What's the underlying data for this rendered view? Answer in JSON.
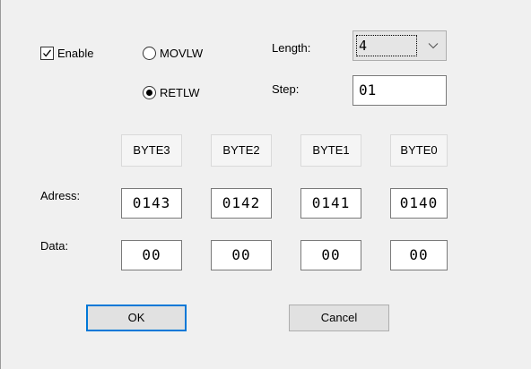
{
  "options": {
    "enable_label": "Enable",
    "enable_checked": true,
    "radio_movlw_label": "MOVLW",
    "radio_retlw_label": "RETLW",
    "selected_radio": "RETLW"
  },
  "settings": {
    "length_label": "Length:",
    "length_value": "4",
    "step_label": "Step:",
    "step_value": "01"
  },
  "table": {
    "byte_headers": [
      "BYTE3",
      "BYTE2",
      "BYTE1",
      "BYTE0"
    ],
    "address_label": "Adress:",
    "addresses": [
      "0143",
      "0142",
      "0141",
      "0140"
    ],
    "data_label": "Data:",
    "data_values": [
      "00",
      "00",
      "00",
      "00"
    ]
  },
  "buttons": {
    "ok_label": "OK",
    "cancel_label": "Cancel"
  }
}
